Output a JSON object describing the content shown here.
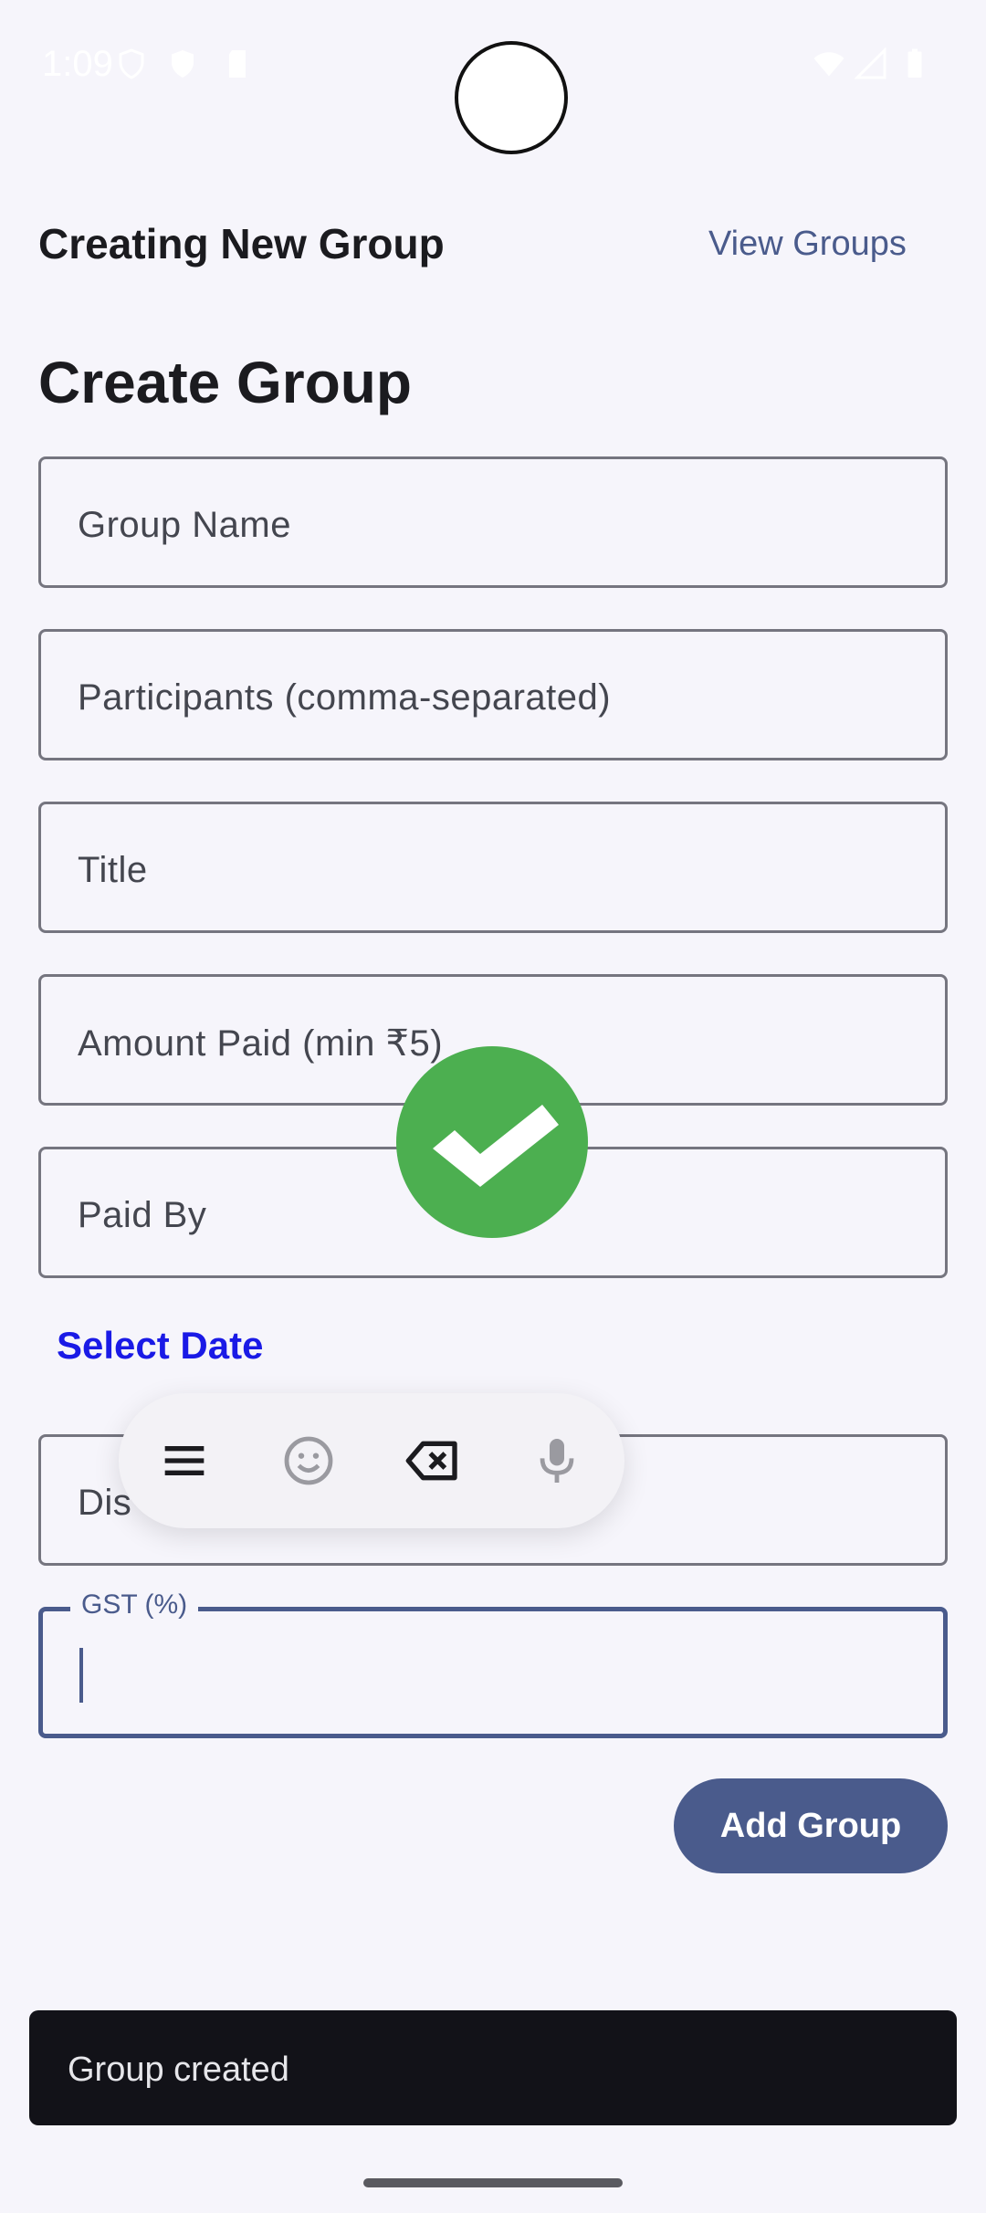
{
  "status_bar": {
    "time": "1:09",
    "icons": [
      "shield-icon",
      "play-protect-icon",
      "sim-icon",
      "wifi-icon",
      "signal-icon",
      "battery-icon"
    ]
  },
  "header": {
    "title": "Creating New Group",
    "view_groups_label": "View Groups"
  },
  "form": {
    "title": "Create Group",
    "fields": [
      {
        "placeholder": "Group Name"
      },
      {
        "placeholder": "Participants (comma-separated)"
      },
      {
        "placeholder": "Title"
      },
      {
        "placeholder": "Amount Paid (min ₹5)"
      },
      {
        "placeholder": "Paid By"
      }
    ],
    "select_date_label": "Select Date",
    "description_placeholder": "Dis",
    "gst_label": "GST (%)",
    "gst_value": "",
    "submit_label": "Add Group"
  },
  "keyboard_toolbar": {
    "items": [
      "menu-icon",
      "emoji-icon",
      "backspace-icon",
      "microphone-icon"
    ]
  },
  "snackbar": {
    "message": "Group created"
  },
  "colors": {
    "accent": "#4a5b8c",
    "success": "#4caf50",
    "link_blue": "#1a1ae6",
    "background": "#f6f5fb",
    "snackbar_bg": "#121218"
  }
}
